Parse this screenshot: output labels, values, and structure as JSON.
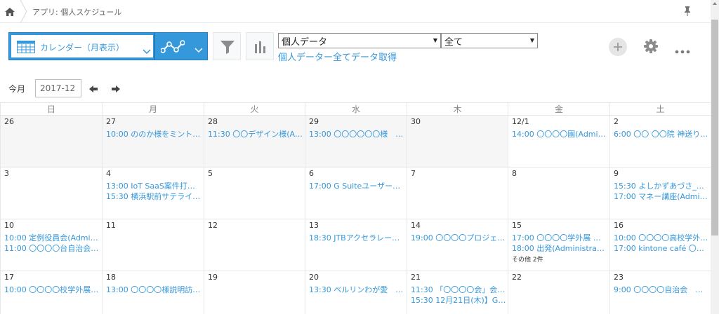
{
  "breadcrumb": {
    "app": "アプリ: 個人スケジュール"
  },
  "toolbar": {
    "view_label": "カレンダー（月表示）",
    "select1": "個人データ",
    "select2": "全て",
    "fetch_link": "個人データー全てデータ取得"
  },
  "nav": {
    "today": "今月",
    "month": "2017-12"
  },
  "colors": {
    "accent": "#3498db",
    "accent_dark": "#217dbb",
    "other_month_bg": "#f6f6f6"
  },
  "icons": [
    "home-icon",
    "pin-icon",
    "calendar-grid-icon",
    "chevron-down-icon",
    "graph-icon",
    "filter-icon",
    "bar-chart-icon",
    "plus-icon",
    "gear-icon",
    "more-icon",
    "arrow-left-icon",
    "arrow-right-icon"
  ],
  "calendar": {
    "weekdays": [
      "日",
      "月",
      "火",
      "水",
      "木",
      "金",
      "土"
    ],
    "weeks": [
      {
        "days": [
          {
            "num": "26",
            "other": true,
            "events": []
          },
          {
            "num": "27",
            "other": true,
            "events": [
              "10:00 ののか様をミントマ…"
            ]
          },
          {
            "num": "28",
            "other": true,
            "events": [
              "11:30 〇〇デザイン様(Ad…"
            ]
          },
          {
            "num": "29",
            "other": true,
            "events": [
              "13:00 〇〇〇〇〇〇様　…"
            ]
          },
          {
            "num": "30",
            "other": true,
            "events": []
          },
          {
            "num": "12/1",
            "other": false,
            "events": [
              "14:00 〇〇〇〇園(Admin…"
            ]
          },
          {
            "num": "2",
            "other": false,
            "events": [
              "6:00 〇〇 〇〇院 神送り(…"
            ]
          }
        ]
      },
      {
        "days": [
          {
            "num": "3",
            "other": false,
            "events": []
          },
          {
            "num": "4",
            "other": false,
            "events": [
              "13:00 IoT SaaS案件打ち…",
              "15:30 横浜駅前サテライ…"
            ]
          },
          {
            "num": "5",
            "other": false,
            "events": []
          },
          {
            "num": "6",
            "other": false,
            "events": [
              "17:00 G Suiteユーザー会…"
            ]
          },
          {
            "num": "7",
            "other": false,
            "events": []
          },
          {
            "num": "8",
            "other": false,
            "events": []
          },
          {
            "num": "9",
            "other": false,
            "events": [
              "15:30 よしかずあづさ_旅…",
              "17:00 マネー講座(Admin…"
            ]
          }
        ]
      },
      {
        "days": [
          {
            "num": "10",
            "other": false,
            "events": [
              "10:00 定例役員会(Admini…",
              "11:00 〇〇〇〇台自治会(…"
            ]
          },
          {
            "num": "11",
            "other": false,
            "events": []
          },
          {
            "num": "12",
            "other": false,
            "events": []
          },
          {
            "num": "13",
            "other": false,
            "events": [
              "18:30 JTBアクセラレータ…"
            ]
          },
          {
            "num": "14",
            "other": false,
            "events": [
              "19:00 〇〇〇〇プロジェ…"
            ]
          },
          {
            "num": "15",
            "other": false,
            "events": [
              "17:00 〇〇〇〇学外展 @…",
              "18:00 出発(Administrator)"
            ],
            "more": "その他 2件"
          },
          {
            "num": "16",
            "other": false,
            "events": [
              "10:00 〇〇〇〇高校学外…",
              "17:00 kintone café 〇〇(…"
            ]
          }
        ]
      },
      {
        "days": [
          {
            "num": "17",
            "other": false,
            "events": [
              "10:00 〇〇〇〇校学外展 …"
            ]
          },
          {
            "num": "18",
            "other": false,
            "events": [
              "13:00 〇〇〇〇様説明訪…"
            ]
          },
          {
            "num": "19",
            "other": false,
            "events": []
          },
          {
            "num": "20",
            "other": false,
            "events": [
              "13:30 ベルリンわが愛　…"
            ]
          },
          {
            "num": "21",
            "other": false,
            "events": [
              "11:30 「〇〇〇〇会」会…",
              "15:30 12月21日(木)】G …"
            ]
          },
          {
            "num": "22",
            "other": false,
            "events": []
          },
          {
            "num": "23",
            "other": false,
            "events": [
              "9:00 〇〇〇〇自治会　分…"
            ]
          }
        ]
      }
    ]
  }
}
